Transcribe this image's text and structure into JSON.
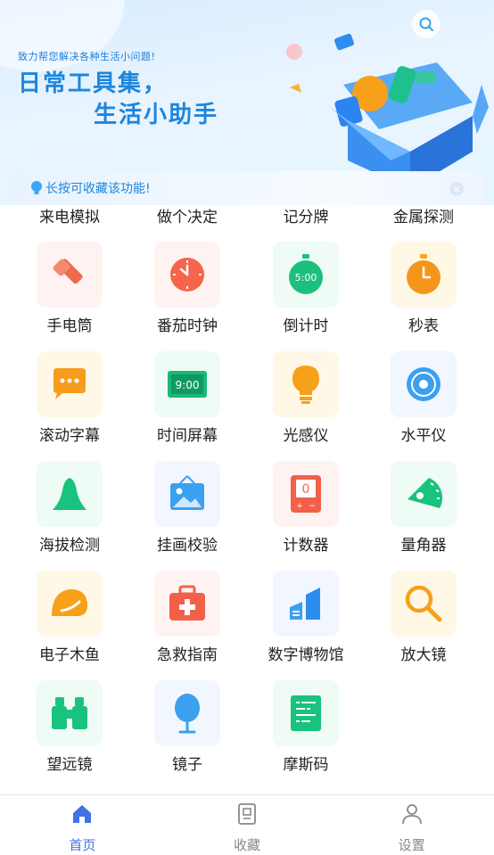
{
  "banner": {
    "tagline": "致力帮您解决各种生活小问题!",
    "headline_line1": "日常工具集，",
    "headline_line2": "生活小助手"
  },
  "tip": {
    "text": "长按可收藏该功能!"
  },
  "partial_row": [
    "来电模拟",
    "做个决定",
    "记分牌",
    "金属探测"
  ],
  "tools": [
    {
      "label": "手电筒",
      "icon": "flashlight-icon"
    },
    {
      "label": "番茄时钟",
      "icon": "clock-icon"
    },
    {
      "label": "倒计时",
      "icon": "stopwatch-icon",
      "icon_text": "5:00"
    },
    {
      "label": "秒表",
      "icon": "timer-icon"
    },
    {
      "label": "滚动字幕",
      "icon": "chat-bubble-icon"
    },
    {
      "label": "时间屏幕",
      "icon": "digital-clock-icon",
      "icon_text": "9:00"
    },
    {
      "label": "光感仪",
      "icon": "lightbulb-icon"
    },
    {
      "label": "水平仪",
      "icon": "level-icon"
    },
    {
      "label": "海拔检测",
      "icon": "mountain-icon"
    },
    {
      "label": "挂画校验",
      "icon": "picture-frame-icon"
    },
    {
      "label": "计数器",
      "icon": "counter-icon",
      "icon_text": "0"
    },
    {
      "label": "量角器",
      "icon": "protractor-icon"
    },
    {
      "label": "电子木鱼",
      "icon": "wooden-fish-icon"
    },
    {
      "label": "急救指南",
      "icon": "first-aid-icon"
    },
    {
      "label": "数字博物馆",
      "icon": "bar-chart-icon"
    },
    {
      "label": "放大镜",
      "icon": "magnifier-icon"
    },
    {
      "label": "望远镜",
      "icon": "binoculars-icon"
    },
    {
      "label": "镜子",
      "icon": "mirror-icon"
    },
    {
      "label": "摩斯码",
      "icon": "morse-code-icon"
    }
  ],
  "tabs": [
    {
      "label": "首页",
      "icon": "home-icon",
      "active": true
    },
    {
      "label": "收藏",
      "icon": "bookmark-icon",
      "active": false
    },
    {
      "label": "设置",
      "icon": "user-icon",
      "active": false
    }
  ],
  "colors": {
    "accent": "#1d86de",
    "tab_active": "#3f73e6",
    "tab_inactive": "#888888"
  }
}
